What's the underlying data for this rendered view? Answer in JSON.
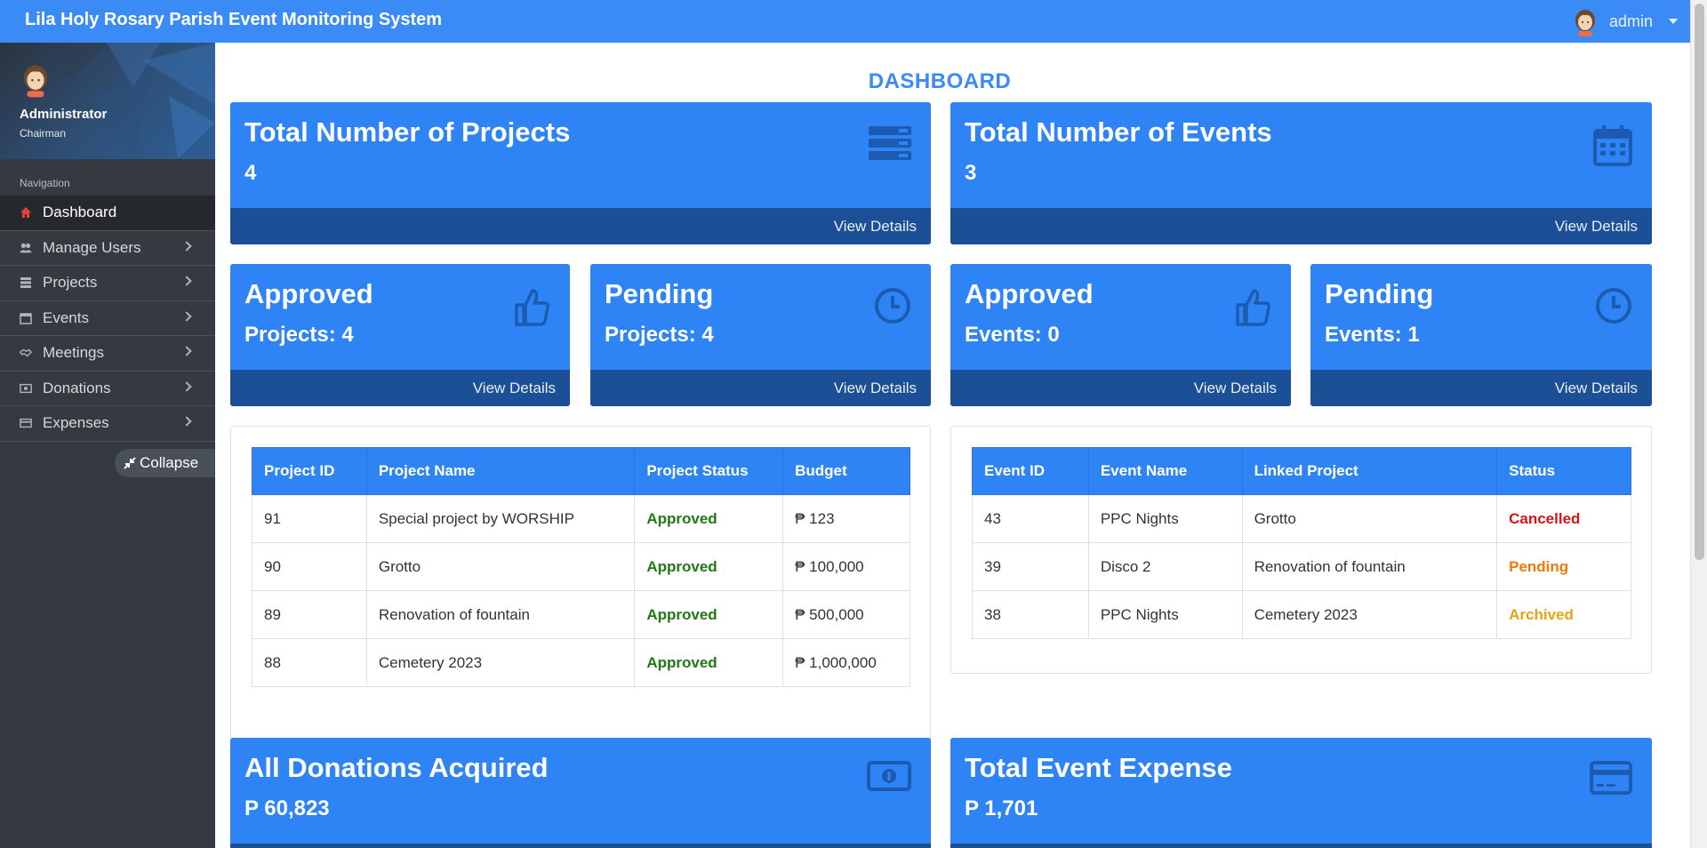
{
  "app": {
    "title": "Lila Holy Rosary Parish Event Monitoring System",
    "user_label": "admin"
  },
  "sidebar": {
    "profile_name": "Administrator",
    "profile_role": "Chairman",
    "nav_label": "Navigation",
    "items": [
      {
        "label": "Dashboard",
        "icon": "home-icon"
      },
      {
        "label": "Manage Users",
        "icon": "users-icon"
      },
      {
        "label": "Projects",
        "icon": "server-icon"
      },
      {
        "label": "Events",
        "icon": "calendar-icon"
      },
      {
        "label": "Meetings",
        "icon": "handshake-icon"
      },
      {
        "label": "Donations",
        "icon": "money-icon"
      },
      {
        "label": "Expenses",
        "icon": "credit-card-icon"
      }
    ],
    "collapse_label": "Collapse"
  },
  "dashboard": {
    "heading": "DASHBOARD",
    "view_details": "View Details",
    "total_projects": {
      "title": "Total Number of Projects",
      "value": "4",
      "icon": "server-icon"
    },
    "total_events": {
      "title": "Total Number of Events",
      "value": "3",
      "icon": "calendar-icon"
    },
    "approved_projects": {
      "title": "Approved",
      "value": "Projects: 4",
      "icon": "thumbs-up-icon"
    },
    "pending_projects": {
      "title": "Pending",
      "value": "Projects: 4",
      "icon": "clock-icon"
    },
    "approved_events": {
      "title": "Approved",
      "value": "Events: 0",
      "icon": "thumbs-up-icon"
    },
    "pending_events": {
      "title": "Pending",
      "value": "Events: 1",
      "icon": "clock-icon"
    },
    "donations": {
      "title": "All Donations Acquired",
      "value": "P 60,823",
      "icon": "money-icon"
    },
    "expenses": {
      "title": "Total Event Expense",
      "value": "P 1,701",
      "icon": "credit-card-icon"
    }
  },
  "projects_table": {
    "headers": [
      "Project ID",
      "Project Name",
      "Project Status",
      "Budget"
    ],
    "rows": [
      [
        "91",
        "Special project by WORSHIP",
        "Approved",
        "₱ 123"
      ],
      [
        "90",
        "Grotto",
        "Approved",
        "₱ 100,000"
      ],
      [
        "89",
        "Renovation of fountain",
        "Approved",
        "₱ 500,000"
      ],
      [
        "88",
        "Cemetery 2023",
        "Approved",
        "₱ 1,000,000"
      ]
    ]
  },
  "events_table": {
    "headers": [
      "Event ID",
      "Event Name",
      "Linked Project",
      "Status"
    ],
    "rows": [
      [
        "43",
        "PPC Nights",
        "Grotto",
        "Cancelled"
      ],
      [
        "39",
        "Disco 2",
        "Renovation of fountain",
        "Pending"
      ],
      [
        "38",
        "PPC Nights",
        "Cemetery 2023",
        "Archived"
      ]
    ]
  },
  "colors": {
    "brand": "#3a8bf5",
    "card": "#2f84f5",
    "card_footer": "#1b4f96",
    "sidebar": "#343a40",
    "approved": "#1f7a12",
    "cancelled": "#d81418",
    "pending": "#ee7a0a",
    "archived": "#e5a50a"
  }
}
